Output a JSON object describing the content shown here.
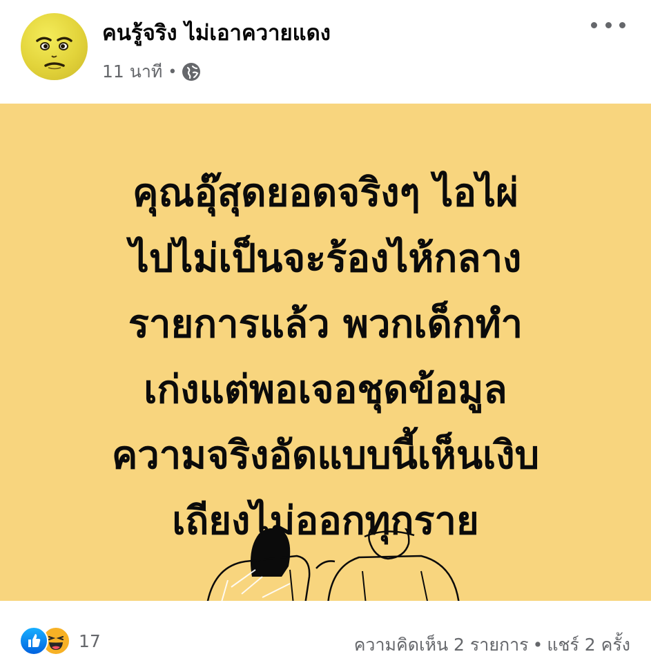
{
  "post": {
    "author": "คนรู้จริง ไม่เอาควายแดง",
    "time": "11 นาที",
    "separator": "•",
    "privacy_icon": "globe-icon",
    "more_icon": "more-options-icon",
    "background_color": "#f8d57e",
    "message_lines": [
      "คุณอุ๊สุดยอดจริงๆ ไอไผ่",
      "ไปไม่เป็นจะร้องไห้กลาง",
      "รายการแล้ว พวกเด็กทำ",
      "เก่งแต่พอเจอชุดข้อมูล",
      "ความจริงอัดแบบนี้เห็นเงิบ",
      "เถียงไม่ออกทุกราย"
    ]
  },
  "footer": {
    "reaction_icons": [
      "like-reaction-icon",
      "haha-reaction-icon"
    ],
    "reaction_count": "17",
    "comments": "ความคิดเห็น 2 รายการ",
    "separator": "•",
    "shares": "แชร์ 2 ครั้ง"
  },
  "colors": {
    "text_primary": "#050505",
    "text_secondary": "#65676b",
    "like_blue": "#1877f2",
    "haha_yellow": "#f7b125"
  }
}
